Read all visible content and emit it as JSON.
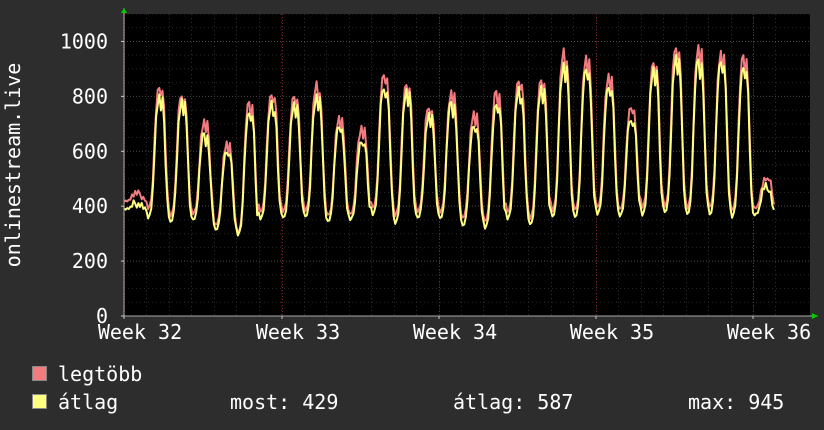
{
  "chart_data": {
    "type": "line",
    "ylabel": "onlinestream.live",
    "ylim": [
      0,
      1100
    ],
    "yticks": [
      0,
      200,
      400,
      600,
      800,
      1000
    ],
    "xticks": [
      "Week 32",
      "Week 33",
      "Week 34",
      "Week 35",
      "Week 36"
    ],
    "grid": true,
    "colors": {
      "background": "#2d2d2d",
      "plot": "#000000",
      "text": "#ffffff",
      "grid": "#3a3a3a"
    },
    "series": [
      {
        "name": "legtöbb",
        "color": "#f27b7f",
        "daily_peaks": [
          445,
          840,
          815,
          705,
          630,
          780,
          810,
          810,
          840,
          720,
          690,
          880,
          850,
          770,
          810,
          740,
          820,
          860,
          870,
          960,
          940,
          880,
          760,
          930,
          990,
          975,
          960,
          950,
          500
        ],
        "daily_lows": [
          420,
          390,
          365,
          375,
          330,
          305,
          380,
          380,
          385,
          365,
          370,
          395,
          365,
          380,
          380,
          355,
          345,
          380,
          355,
          385,
          385,
          395,
          390,
          395,
          400,
          395,
          395,
          385,
          395
        ]
      },
      {
        "name": "átlag",
        "color": "#ffff80",
        "daily_peaks": [
          410,
          795,
          785,
          665,
          600,
          750,
          770,
          770,
          805,
          690,
          640,
          840,
          815,
          735,
          780,
          695,
          780,
          820,
          830,
          920,
          900,
          840,
          725,
          895,
          945,
          935,
          930,
          915,
          470
        ],
        "daily_lows": [
          390,
          360,
          340,
          350,
          315,
          295,
          355,
          355,
          360,
          345,
          350,
          370,
          340,
          355,
          355,
          330,
          320,
          355,
          330,
          360,
          360,
          370,
          365,
          370,
          375,
          370,
          370,
          360,
          370
        ]
      }
    ]
  },
  "legend": {
    "items": [
      {
        "label": "legtöbb",
        "color": "#f27b7f"
      },
      {
        "label": "átlag",
        "color": "#ffff80"
      }
    ],
    "stats": {
      "most_label": "most:",
      "most_value": "429",
      "atlag_label": "átlag:",
      "atlag_value": "587",
      "max_label": "max:",
      "max_value": "945"
    }
  }
}
